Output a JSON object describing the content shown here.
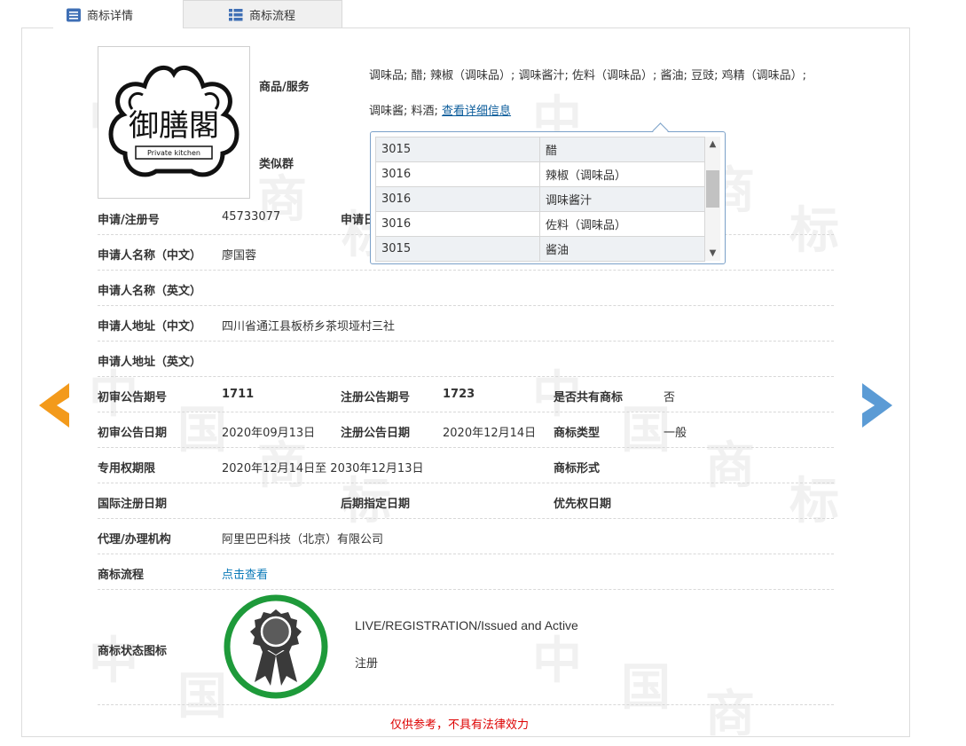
{
  "tabs": [
    {
      "label": "商标详情",
      "icon": "document-list-icon",
      "active": true
    },
    {
      "label": "商标流程",
      "icon": "grid-list-icon",
      "active": false
    }
  ],
  "logo": {
    "main_text": "御膳閣",
    "sub_text": "Private kitchen"
  },
  "goods": {
    "label": "商品/服务",
    "line1": "调味品; 醋; 辣椒（调味品）; 调味酱汁; 佐料（调味品）; 酱油; 豆豉; 鸡精（调味品）;",
    "line2": "调味酱; 料酒;",
    "detail_link": "查看详细信息"
  },
  "similar_group_label": "类似群",
  "popup_rows": [
    {
      "code": "3015",
      "name": "醋"
    },
    {
      "code": "3016",
      "name": "辣椒（调味品）"
    },
    {
      "code": "3016",
      "name": "调味酱汁"
    },
    {
      "code": "3016",
      "name": "佐料（调味品）"
    },
    {
      "code": "3015",
      "name": "酱油"
    }
  ],
  "fields": {
    "reg_no_label": "申请/注册号",
    "reg_no": "45733077",
    "app_date_label_partial": "申请日",
    "applicant_cn_label": "申请人名称（中文）",
    "applicant_cn": "廖国蓉",
    "applicant_en_label": "申请人名称（英文）",
    "address_cn_label": "申请人地址（中文）",
    "address_cn": "四川省通江县板桥乡茶坝垭村三社",
    "address_en_label": "申请人地址（英文）",
    "prelim_no_label": "初审公告期号",
    "prelim_no": "1711",
    "reg_ann_no_label": "注册公告期号",
    "reg_ann_no": "1723",
    "shared_label": "是否共有商标",
    "shared": "否",
    "prelim_date_label": "初审公告日期",
    "prelim_date": "2020年09月13日",
    "reg_ann_date_label": "注册公告日期",
    "reg_ann_date": "2020年12月14日",
    "tm_type_label": "商标类型",
    "tm_type": "一般",
    "exclusive_label": "专用权期限",
    "exclusive": "2020年12月14日至 2030年12月13日",
    "tm_form_label": "商标形式",
    "intl_date_label": "国际注册日期",
    "later_date_label": "后期指定日期",
    "priority_label": "优先权日期",
    "agent_label": "代理/办理机构",
    "agent": "阿里巴巴科技（北京）有限公司",
    "flow_label": "商标流程",
    "flow_link": "点击查看",
    "status_icon_label": "商标状态图标",
    "status_en": "LIVE/REGISTRATION/Issued and Active",
    "status_cn": "注册"
  },
  "disclaimer": "仅供参考，不具有法律效力",
  "colors": {
    "prev_arrow": "#f39a1b",
    "next_arrow": "#5b9bd5",
    "badge_ring": "#1e9a3a",
    "link": "#0b7ab8"
  }
}
